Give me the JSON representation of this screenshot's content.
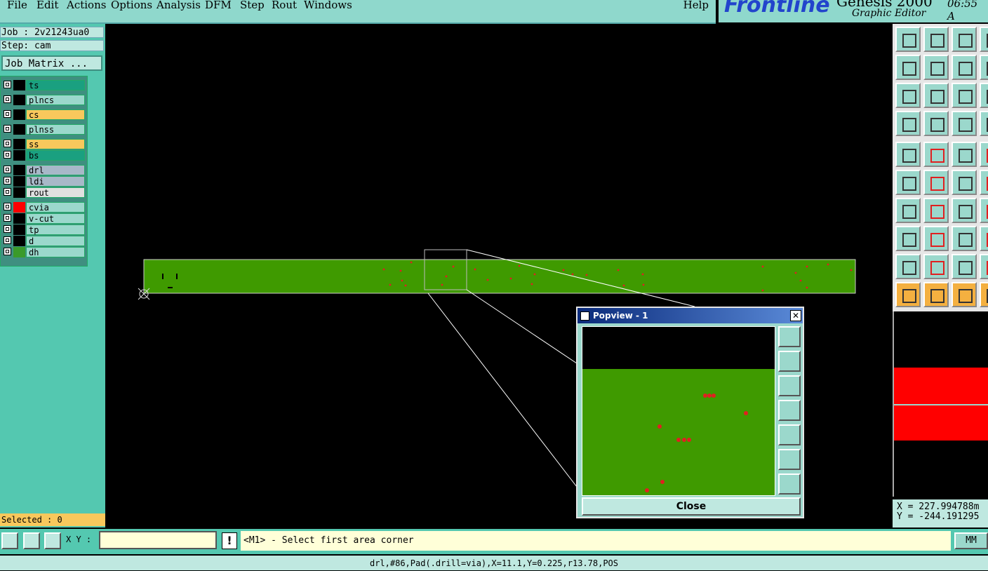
{
  "menubar": {
    "items": [
      "File",
      "Edit",
      "Actions",
      "Options",
      "Analysis",
      "DFM",
      "Step",
      "Rout",
      "Windows"
    ],
    "help": "Help"
  },
  "brand": {
    "logo": "Frontline",
    "product": "Genesis 2000",
    "subtitle": "Graphic Editor",
    "clock": "06:55 A"
  },
  "left": {
    "job": "Job : 2v21243ua0",
    "step": "Step: cam",
    "job_matrix": "Job Matrix ...",
    "layers": [
      {
        "name": "ts",
        "color": "#1aa080",
        "swatch": "#000000"
      },
      {
        "name": "plncs",
        "color": "#9bd8cc",
        "swatch": "#000000"
      },
      {
        "name": "cs",
        "color": "#f8c85c",
        "swatch": "#000000"
      },
      {
        "name": "plnss",
        "color": "#9bd8cc",
        "swatch": "#000000"
      },
      {
        "name": "ss",
        "color": "#f8c85c",
        "swatch": "#000000"
      },
      {
        "name": "bs",
        "color": "#1aa080",
        "swatch": "#000000"
      },
      {
        "name": "drl",
        "color": "#a8b8c8",
        "swatch": "#000000"
      },
      {
        "name": "ldi",
        "color": "#a8b8c8",
        "swatch": "#000000"
      },
      {
        "name": "rout",
        "color": "#e0e0e0",
        "swatch": "#000000"
      },
      {
        "name": "cvia",
        "color": "#9bd8cc",
        "swatch": "#ff0000"
      },
      {
        "name": "v-cut",
        "color": "#9bd8cc",
        "swatch": "#000000"
      },
      {
        "name": "tp",
        "color": "#9bd8cc",
        "swatch": "#000000"
      },
      {
        "name": "d",
        "color": "#9bd8cc",
        "swatch": "#000000"
      },
      {
        "name": "dh",
        "color": "#9bd8cc",
        "swatch": "#3a9a2a"
      }
    ],
    "selected": "Selected : 0"
  },
  "readout": {
    "x": "X = 227.994788m",
    "y": "Y = -244.191295"
  },
  "bottom": {
    "xy_label": "X Y :",
    "xy_value": "",
    "prompt": "<M1> - Select first area corner",
    "units": "MM"
  },
  "status": "drl,#86,Pad(.drill=via),X=11.1,Y=0.225,r13.78,POS",
  "popview": {
    "title": "Popview - 1",
    "close": "Close"
  },
  "colors": {
    "board": "#3f9a00",
    "pad": "#e02020"
  }
}
